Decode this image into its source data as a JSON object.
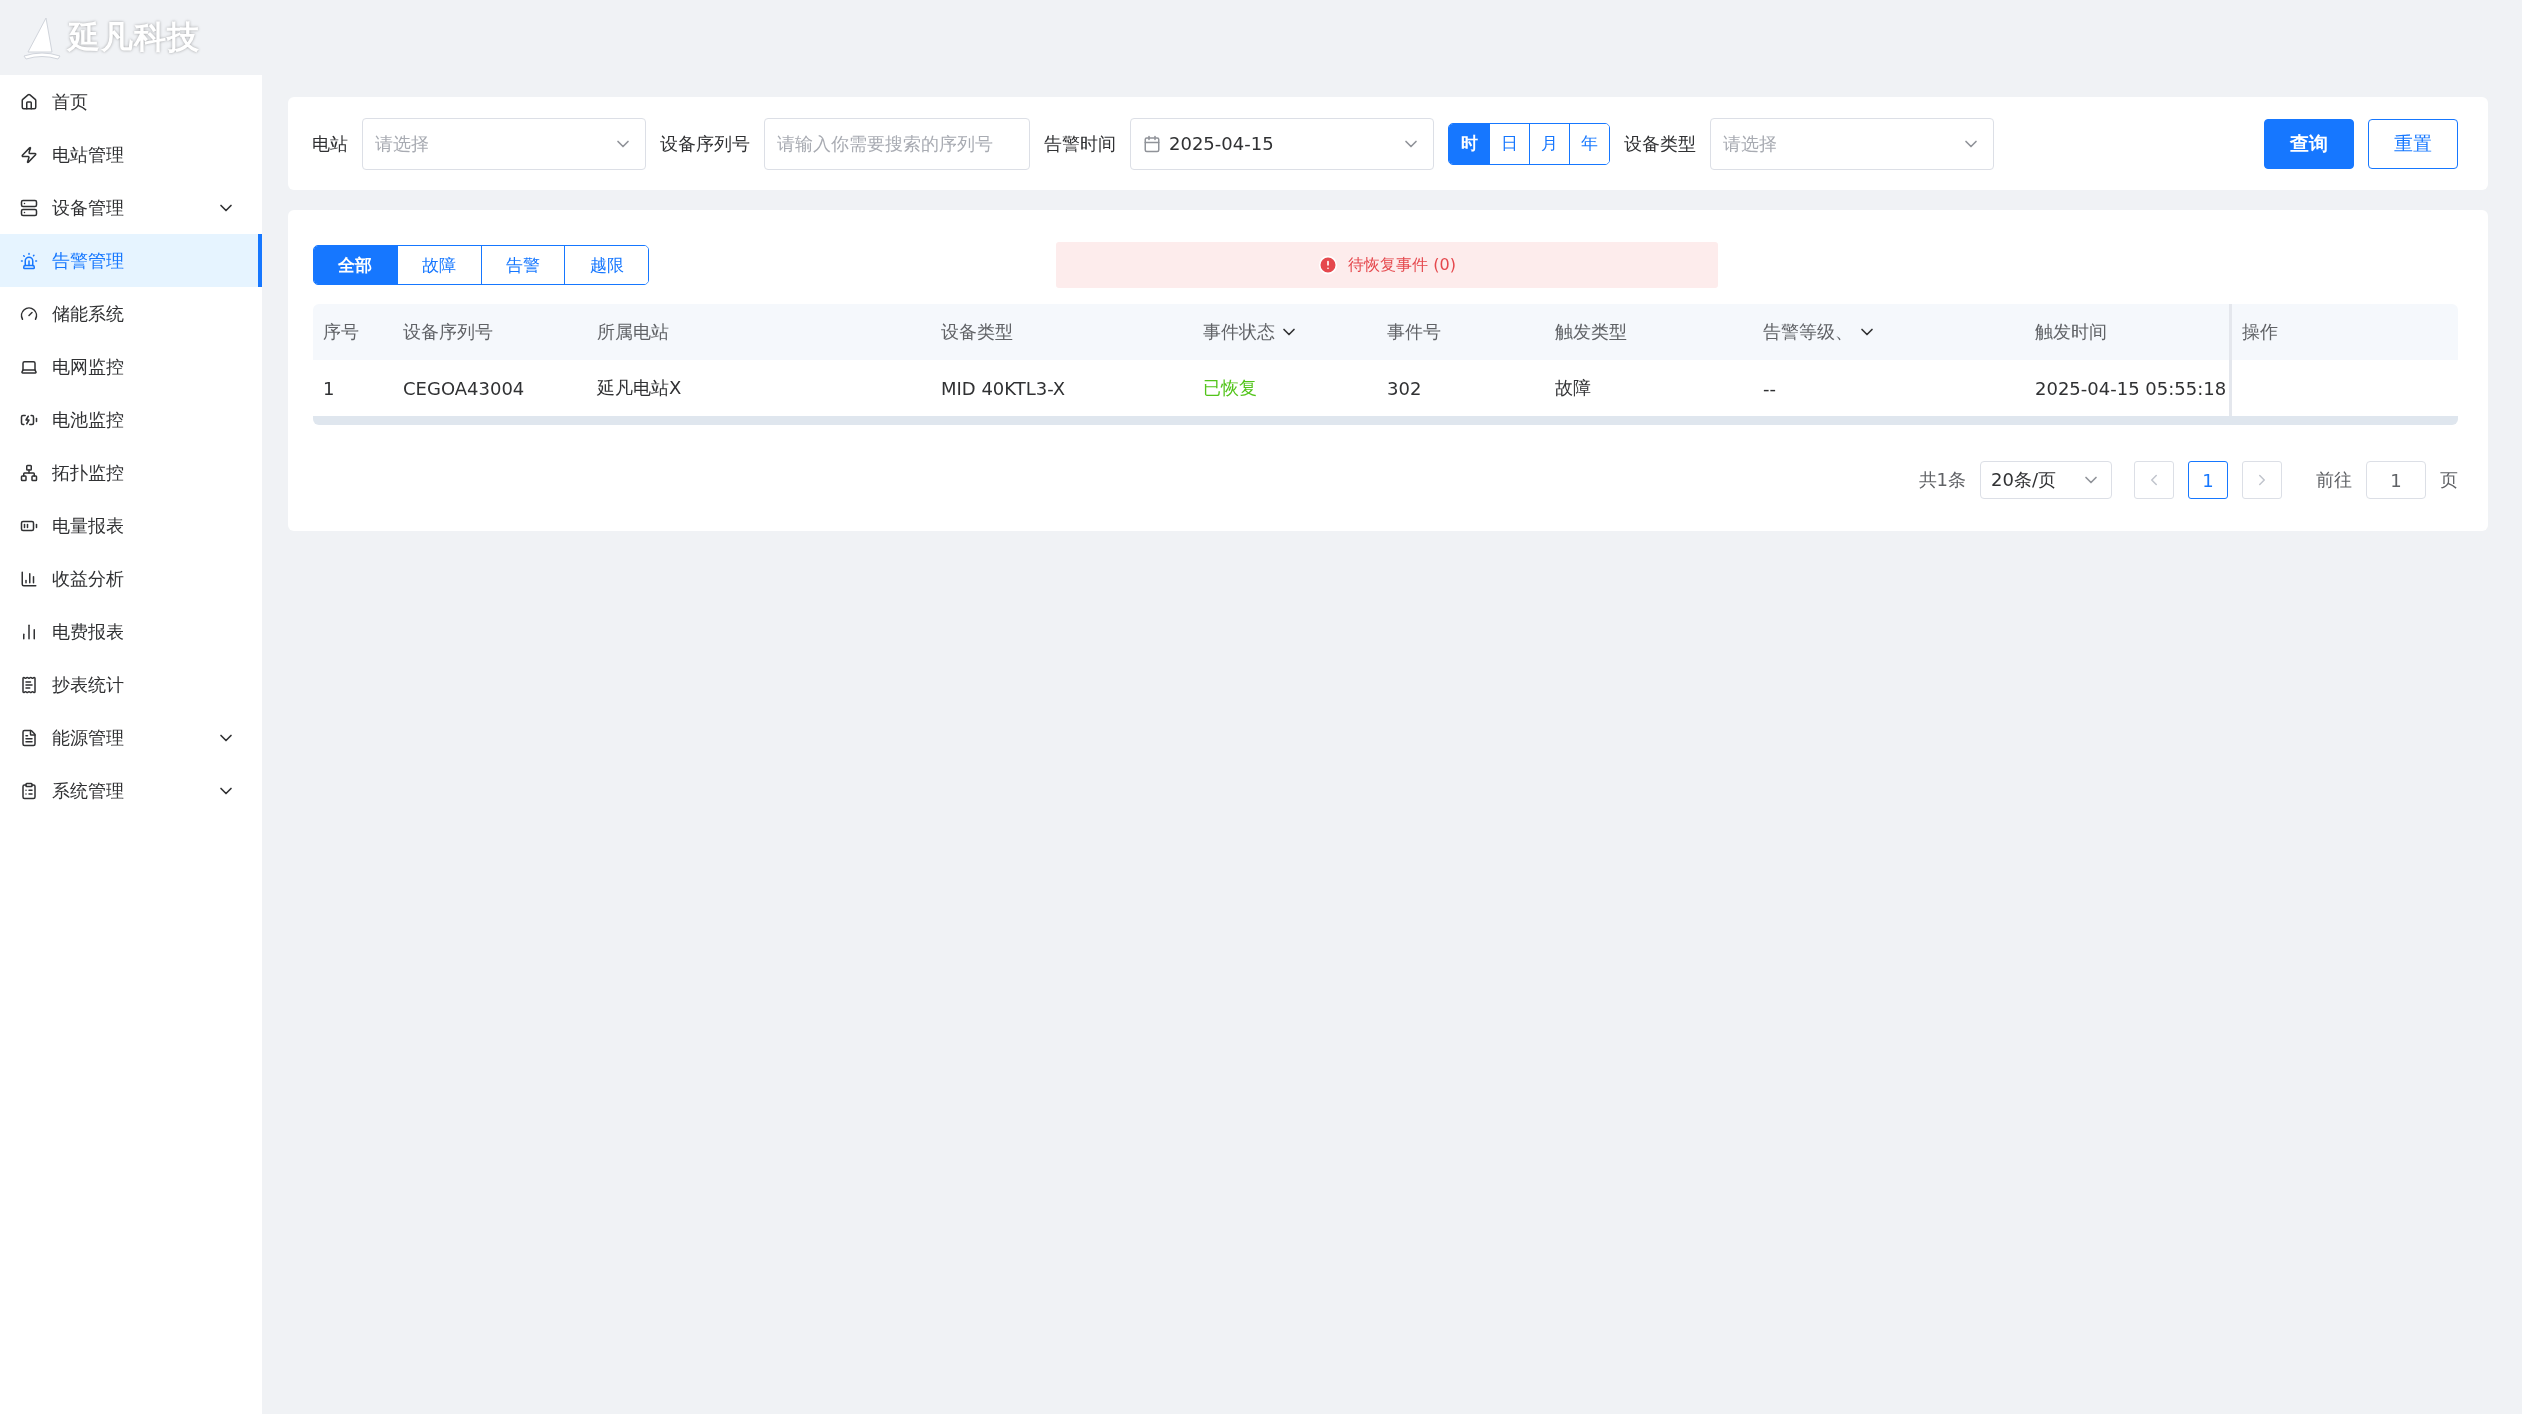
{
  "logo": {
    "text": "延凡科技"
  },
  "menu": [
    {
      "label": "首页",
      "expandable": false,
      "selected": false
    },
    {
      "label": "电站管理",
      "expandable": false,
      "selected": false
    },
    {
      "label": "设备管理",
      "expandable": true,
      "selected": false
    },
    {
      "label": "告警管理",
      "expandable": false,
      "selected": true
    },
    {
      "label": "储能系统",
      "expandable": false,
      "selected": false
    },
    {
      "label": "电网监控",
      "expandable": false,
      "selected": false
    },
    {
      "label": "电池监控",
      "expandable": false,
      "selected": false
    },
    {
      "label": "拓扑监控",
      "expandable": false,
      "selected": false
    },
    {
      "label": "电量报表",
      "expandable": false,
      "selected": false
    },
    {
      "label": "收益分析",
      "expandable": false,
      "selected": false
    },
    {
      "label": "电费报表",
      "expandable": false,
      "selected": false
    },
    {
      "label": "抄表统计",
      "expandable": false,
      "selected": false
    },
    {
      "label": "能源管理",
      "expandable": true,
      "selected": false
    },
    {
      "label": "系统管理",
      "expandable": true,
      "selected": false
    }
  ],
  "filters": [
    {
      "kind": "select",
      "label": "电站",
      "placeholder": "请选择"
    },
    {
      "kind": "input",
      "label": "设备序列号",
      "placeholder": "请输入你需要搜索的序列号"
    },
    {
      "kind": "date",
      "label": "告警时间",
      "value": "2025-04-15",
      "granularity": [
        {
          "label": "时",
          "selected": true
        },
        {
          "label": "日",
          "selected": false
        },
        {
          "label": "月",
          "selected": false
        },
        {
          "label": "年",
          "selected": false
        }
      ]
    },
    {
      "kind": "select",
      "label": "设备类型",
      "placeholder": "请选择"
    }
  ],
  "buttons": [
    {
      "label": "查询",
      "primary": true
    },
    {
      "label": "重置",
      "primary": false
    }
  ],
  "tabs": [
    {
      "label": "全部",
      "selected": true
    },
    {
      "label": "故障",
      "selected": false
    },
    {
      "label": "告警",
      "selected": false
    },
    {
      "label": "越限",
      "selected": false
    }
  ],
  "banner": {
    "text": "待恢复事件 (0)"
  },
  "table": {
    "columns": [
      {
        "label": "序号",
        "filter": false,
        "kind": "text"
      },
      {
        "label": "设备序列号",
        "filter": false,
        "kind": "text"
      },
      {
        "label": "所属电站",
        "filter": false,
        "kind": "text"
      },
      {
        "label": "设备类型",
        "filter": false,
        "kind": "text"
      },
      {
        "label": "事件状态",
        "filter": true,
        "kind": "status"
      },
      {
        "label": "事件号",
        "filter": false,
        "kind": "text"
      },
      {
        "label": "触发类型",
        "filter": false,
        "kind": "text"
      },
      {
        "label": "告警等级、",
        "filter": true,
        "kind": "text"
      },
      {
        "label": "触发时间",
        "filter": false,
        "kind": "text"
      },
      {
        "label": "操作",
        "filter": false,
        "kind": "text"
      }
    ],
    "rows": [
      [
        "1",
        "CEGOA43004",
        "延凡电站X",
        "MID 40KTL3-X",
        "已恢复",
        "302",
        "故障",
        "--",
        "2025-04-15 05:55:18",
        ""
      ]
    ]
  },
  "pagination": {
    "total": "共1条",
    "page_size": "20条/页",
    "prev_disabled": true,
    "next_disabled": true,
    "pages": [
      {
        "label": "1",
        "selected": true
      }
    ],
    "goto_label": "前往",
    "goto_value": "1",
    "goto_suffix": "页"
  }
}
